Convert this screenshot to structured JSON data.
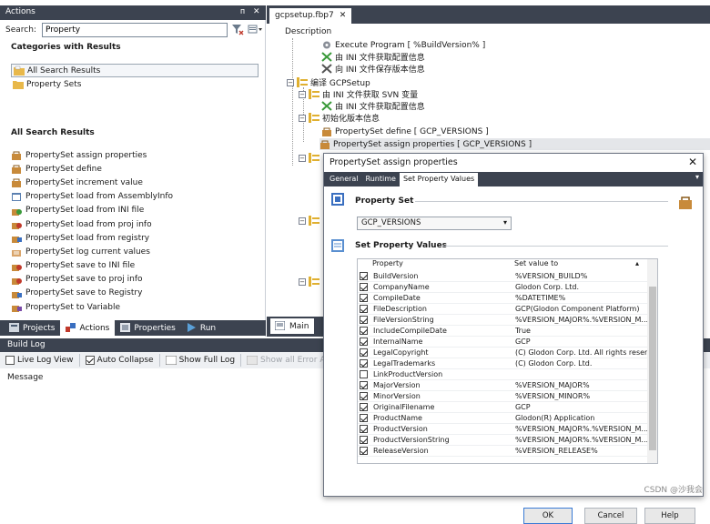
{
  "actions_panel": {
    "title": "Actions",
    "pin_glyph": "ᴨ",
    "close_glyph": "✕",
    "search_label": "Search:",
    "search_value": "Property",
    "categories_heading": "Categories with Results",
    "categories": [
      "All Search Results",
      "Property Sets"
    ],
    "results_heading": "All Search Results",
    "results": [
      "PropertySet assign properties",
      "PropertySet define",
      "PropertySet increment value",
      "PropertySet load from AssemblyInfo",
      "PropertySet load from INI file",
      "PropertySet load from proj info",
      "PropertySet load from registry",
      "PropertySet log current values",
      "PropertySet save to INI file",
      "PropertySet save to proj info",
      "PropertySet save to Registry",
      "PropertySet to Variable"
    ],
    "tabs": [
      "Projects",
      "Actions",
      "Properties",
      "Run"
    ]
  },
  "build_log": {
    "title": "Build Log",
    "live_log_view": "Live Log View",
    "auto_collapse": "Auto Collapse",
    "show_full_log": "Show Full Log",
    "show_all_errors": "Show all Error Actions",
    "message_header": "Message"
  },
  "document": {
    "tab_name": "gcpsetup.fbp7",
    "tab_close": "✕",
    "description_header": "Description",
    "tree": [
      "Execute Program [ %BuildVersion% ]",
      "由 INI 文件获取配置信息",
      "向 INI 文件保存版本信息",
      "编译 GCPSetup",
      "由 INI 文件获取 SVN 变量",
      "由 INI 文件获取配置信息",
      "初始化版本信息",
      "PropertySet define [ GCP_VERSIONS ]",
      "PropertySet assign properties [ GCP_VERSIONS ]"
    ],
    "bottom_tab": "Main"
  },
  "dialog": {
    "title": "PropertySet assign properties",
    "close_glyph": "✕",
    "tabs": [
      "General",
      "Runtime",
      "Set Property Values"
    ],
    "property_set_group": "Property Set",
    "property_set_value": "GCP_VERSIONS",
    "set_values_group": "Set Property Values",
    "col_property": "Property",
    "col_value": "Set value to",
    "rows": [
      {
        "name": "BuildVersion",
        "value": "%VERSION_BUILD%",
        "checked": true
      },
      {
        "name": "CompanyName",
        "value": "Glodon Corp. Ltd.",
        "checked": true
      },
      {
        "name": "CompileDate",
        "value": "%DATETIME%",
        "checked": true
      },
      {
        "name": "FileDescription",
        "value": "GCP(Glodon Component Platform)",
        "checked": true
      },
      {
        "name": "FileVersionString",
        "value": "%VERSION_MAJOR%.%VERSION_M...",
        "checked": true
      },
      {
        "name": "IncludeCompileDate",
        "value": "True",
        "checked": true
      },
      {
        "name": "InternalName",
        "value": "GCP",
        "checked": true
      },
      {
        "name": "LegalCopyright",
        "value": "(C) Glodon Corp. Ltd. All rights reserved.",
        "checked": true
      },
      {
        "name": "LegalTrademarks",
        "value": "(C) Glodon Corp. Ltd.",
        "checked": true
      },
      {
        "name": "LinkProductVersion",
        "value": "",
        "checked": false
      },
      {
        "name": "MajorVersion",
        "value": "%VERSION_MAJOR%",
        "checked": true
      },
      {
        "name": "MinorVersion",
        "value": "%VERSION_MINOR%",
        "checked": true
      },
      {
        "name": "OriginalFilename",
        "value": "GCP",
        "checked": true
      },
      {
        "name": "ProductName",
        "value": "Glodon(R) Application",
        "checked": true
      },
      {
        "name": "ProductVersion",
        "value": "%VERSION_MAJOR%.%VERSION_M...",
        "checked": true
      },
      {
        "name": "ProductVersionString",
        "value": "%VERSION_MAJOR%.%VERSION_M...",
        "checked": true
      },
      {
        "name": "ReleaseVersion",
        "value": "%VERSION_RELEASE%",
        "checked": true
      }
    ],
    "ok": "OK",
    "cancel": "Cancel",
    "help": "Help"
  },
  "watermark": "CSDN @沙我会",
  "colors": {
    "panel_title_bg": "#3c4350",
    "accent_blue": "#3a7bd5"
  }
}
